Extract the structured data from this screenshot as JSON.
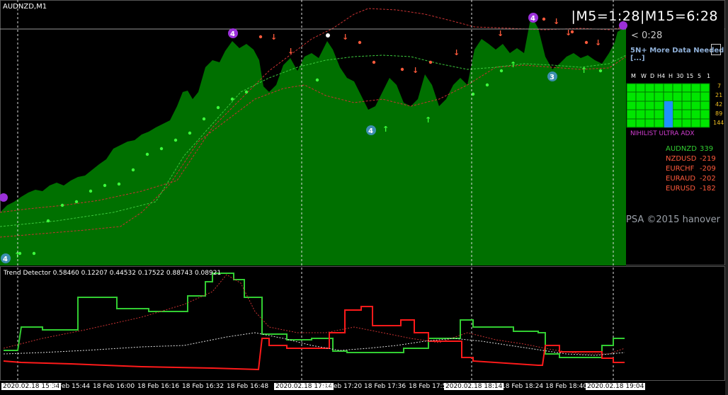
{
  "chart": {
    "symbol_title": "AUDNZD,M1",
    "timer_readout": "|M5=1:28|M15=6:28",
    "countdown": "< 0:28",
    "data_warning": "5N+  More Data Needed  [...]",
    "copyright": "PSA ©2015 hanover",
    "indicator_title": "Trend Detector 0.58460 0.12207 0.44532 0.17522 0.88743 0.08921"
  },
  "adx_panel": {
    "timeframes": [
      "M",
      "W",
      "D",
      "H4",
      "H",
      "30",
      "15",
      "5",
      "1"
    ],
    "periods": [
      "7",
      "21",
      "42",
      "89",
      "144"
    ],
    "title": "NIHILIST ULTRA ADX",
    "colors": {
      "active": "#00e600",
      "highlight": "#1e90ff",
      "grid": "#008000"
    }
  },
  "strength_list": [
    {
      "pair": "AUDNZD",
      "value": "339",
      "color": "#32cd32"
    },
    {
      "pair": "NZDUSD",
      "value": "-219",
      "color": "#ff5a3c"
    },
    {
      "pair": "EURCHF",
      "value": "-209",
      "color": "#ff5a3c"
    },
    {
      "pair": "EURAUD",
      "value": "-202",
      "color": "#ff5a3c"
    },
    {
      "pair": "EURUSD",
      "value": "-182",
      "color": "#ff5a3c"
    }
  ],
  "time_axis": [
    {
      "label": "2020.02.18 15:34",
      "boxed": true
    },
    {
      "label": "18 Feb 15:44",
      "boxed": false
    },
    {
      "label": "18 Feb 16:00",
      "boxed": false
    },
    {
      "label": "18 Feb 16:16",
      "boxed": false
    },
    {
      "label": "18 Feb 16:32",
      "boxed": false
    },
    {
      "label": "18 Feb 16:48",
      "boxed": false
    },
    {
      "label": "2020.02.18 17:14",
      "boxed": true
    },
    {
      "label": "18 Feb 17:20",
      "boxed": false
    },
    {
      "label": "18 Feb 17:36",
      "boxed": false
    },
    {
      "label": "18 Feb 17:5",
      "boxed": false
    },
    {
      "label": "2020.02.18 18:14",
      "boxed": true
    },
    {
      "label": "18 Feb 18:24",
      "boxed": false
    },
    {
      "label": "18 Feb 18:40",
      "boxed": false
    },
    {
      "label": "2020.02.18 19:04",
      "boxed": true
    }
  ],
  "markers": [
    {
      "text": "4",
      "color": "#9b30d9"
    },
    {
      "text": "4",
      "color": "#9b30d9"
    },
    {
      "text": "4",
      "color": "#3d8fb0"
    },
    {
      "text": "4",
      "color": "#3d8fb0"
    },
    {
      "text": "3",
      "color": "#3d8fb0"
    }
  ],
  "colors": {
    "price_fill": "#007000",
    "trend_green": "#32cd32",
    "trend_red": "#ff1a1a",
    "band_red": "#c83232"
  }
}
